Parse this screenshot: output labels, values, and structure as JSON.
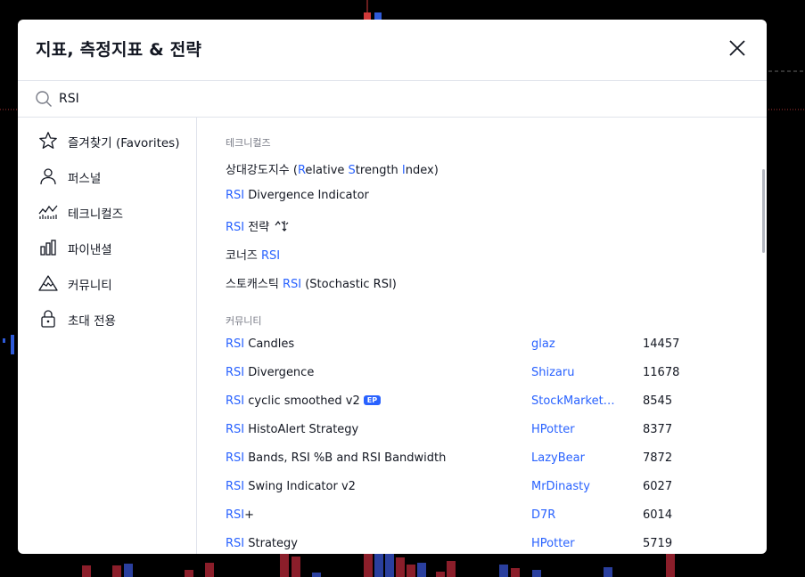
{
  "dialog": {
    "title": "지표, 측정지표 & 전략",
    "close_icon": "close-icon"
  },
  "search": {
    "value": "RSI",
    "icon": "search-icon"
  },
  "sidebar": {
    "items": [
      {
        "label": "즐겨찾기 (Favorites)",
        "icon": "star-icon"
      },
      {
        "label": "퍼스널",
        "icon": "person-icon"
      },
      {
        "label": "테크니컬즈",
        "icon": "chart-line-icon"
      },
      {
        "label": "파이낸셜",
        "icon": "bar-chart-icon"
      },
      {
        "label": "커뮤니티",
        "icon": "mountain-icon"
      },
      {
        "label": "초대 전용",
        "icon": "lock-icon"
      }
    ]
  },
  "main": {
    "technicals": {
      "title": "테크니컬즈",
      "items": [
        {
          "pre": "상대강도지수 (",
          "parts": [
            [
              "R",
              "hl"
            ],
            [
              "elative ",
              ""
            ],
            [
              "S",
              "hl"
            ],
            [
              "trength ",
              ""
            ],
            [
              "I",
              "hl"
            ],
            [
              "ndex)",
              ""
            ]
          ]
        },
        {
          "parts": [
            [
              "RSI",
              "hl"
            ],
            [
              " Divergence Indicator",
              ""
            ]
          ]
        },
        {
          "parts": [
            [
              "RSI",
              "hl"
            ],
            [
              " 전략",
              ""
            ]
          ],
          "strategy_icon": "strategy-icon"
        },
        {
          "parts": [
            [
              "코너즈 ",
              ""
            ],
            [
              "RSI",
              "hl"
            ]
          ]
        },
        {
          "parts": [
            [
              "스토캐스틱 ",
              ""
            ],
            [
              "RSI",
              "hl"
            ],
            [
              " (Stochastic RSI)",
              ""
            ]
          ]
        }
      ]
    },
    "community": {
      "title": "커뮤니티",
      "items": [
        {
          "parts": [
            [
              "RSI",
              "hl"
            ],
            [
              " Candles",
              ""
            ]
          ],
          "author": "glaz",
          "likes": "14457"
        },
        {
          "parts": [
            [
              "RSI",
              "hl"
            ],
            [
              " Divergence",
              ""
            ]
          ],
          "author": "Shizaru",
          "likes": "11678"
        },
        {
          "parts": [
            [
              "RSI",
              "hl"
            ],
            [
              " cyclic smoothed v2",
              ""
            ]
          ],
          "badge": "EP",
          "author": "StockMarketCycles",
          "likes": "8545"
        },
        {
          "parts": [
            [
              "RSI",
              "hl"
            ],
            [
              " HistoAlert Strategy",
              ""
            ]
          ],
          "author": "HPotter",
          "likes": "8377"
        },
        {
          "parts": [
            [
              "RSI",
              "hl"
            ],
            [
              " Bands, RSI %B and RSI Bandwidth",
              ""
            ]
          ],
          "author": "LazyBear",
          "likes": "7872"
        },
        {
          "parts": [
            [
              "RSI",
              "hl"
            ],
            [
              " Swing Indicator v2",
              ""
            ]
          ],
          "author": "MrDinasty",
          "likes": "6027"
        },
        {
          "parts": [
            [
              "RSI",
              "hl"
            ],
            [
              "+",
              ""
            ]
          ],
          "author": "D7R",
          "likes": "6014"
        },
        {
          "parts": [
            [
              "RSI",
              "hl"
            ],
            [
              " Strategy",
              ""
            ]
          ],
          "author": "HPotter",
          "likes": "5719"
        }
      ]
    }
  },
  "colors": {
    "accent": "#2962ff",
    "text": "#131722",
    "muted": "#787b86",
    "candle_up": "#2a3f9e",
    "candle_down": "#8b1e2a"
  }
}
